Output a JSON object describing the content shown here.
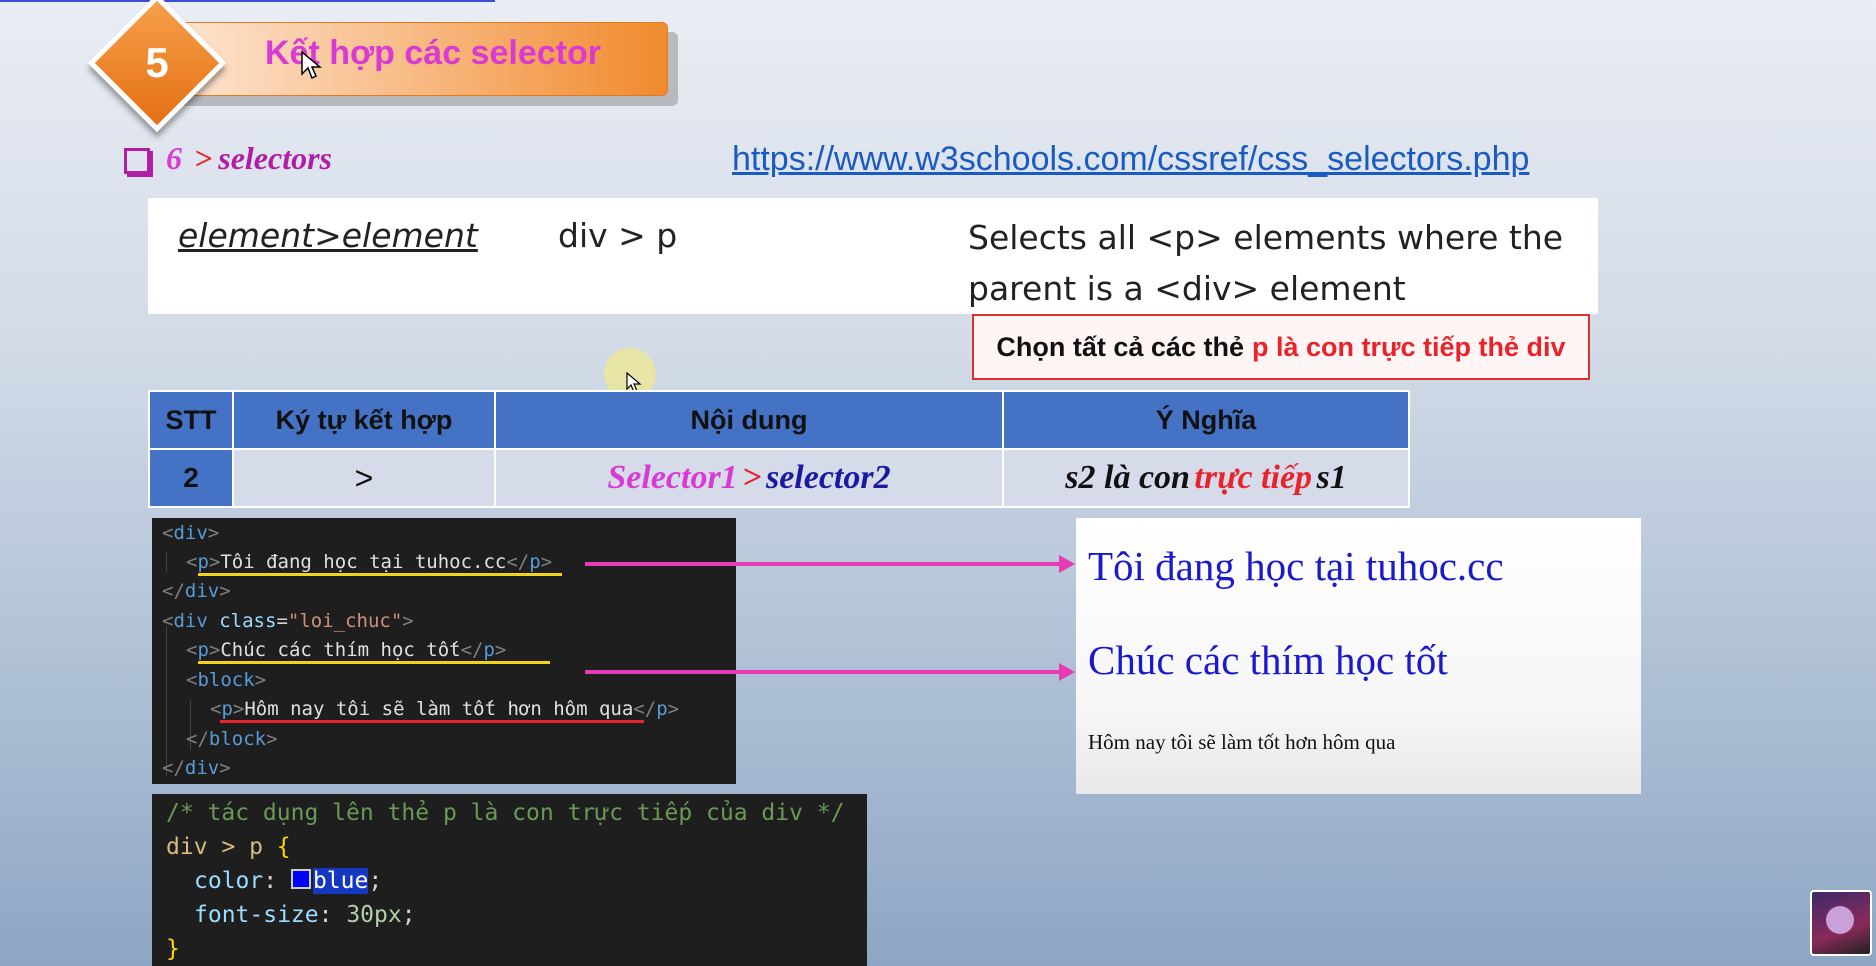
{
  "title": {
    "number": "5",
    "text": "Kết hợp các selector"
  },
  "subtitle": {
    "num": "6",
    "op": ">",
    "word": "selectors"
  },
  "link": "https://www.w3schools.com/cssref/css_selectors.php",
  "reference": {
    "selector": "element>element",
    "example": "div > p",
    "description": "Selects all <p> elements where the parent is a <div> element"
  },
  "note": {
    "part1": "Chọn tất cả các thẻ",
    "part2": "p là con trực tiếp thẻ div"
  },
  "table": {
    "headers": [
      "STT",
      "Ký tự kết hợp",
      "Nội dung",
      "Ý Nghĩa"
    ],
    "row": {
      "stt": "2",
      "op": ">",
      "content": {
        "s1": "Selector1",
        "op": ">",
        "s2": "selector2"
      },
      "meaning": {
        "a": "s2 là con",
        "b": "trực tiếp",
        "c": "s1"
      }
    }
  },
  "html_code": {
    "div_open": "div",
    "p": "p",
    "text1": "Tôi đang học tại tuhoc.cc",
    "class_attr": "class",
    "class_val": "\"loi_chuc\"",
    "text2": "Chúc các thím học tốt",
    "block": "block",
    "text3": "Hôm nay tôi sẽ làm tốt hơn hôm qua"
  },
  "css_code": {
    "comment": "/* tác dụng lên thẻ p là con trực tiếp của div */",
    "selector": "div > p",
    "prop1": "color",
    "val1": "blue",
    "prop2": "font-size",
    "val2": "30px"
  },
  "result": {
    "line1": "Tôi đang học tại tuhoc.cc",
    "line2": "Chúc các thím học tốt",
    "line3": "Hôm nay tôi sẽ làm tốt hơn hôm qua"
  },
  "colors": {
    "accent": "#f08a2c",
    "magenta": "#d93ad6",
    "red": "#e8232a",
    "header_blue": "#4472c4",
    "result_blue": "#1a1acc"
  },
  "icons": [
    "mouse-cursor-icon",
    "checkbox-bullet-icon",
    "arrow-right-icon",
    "channel-avatar-icon"
  ]
}
